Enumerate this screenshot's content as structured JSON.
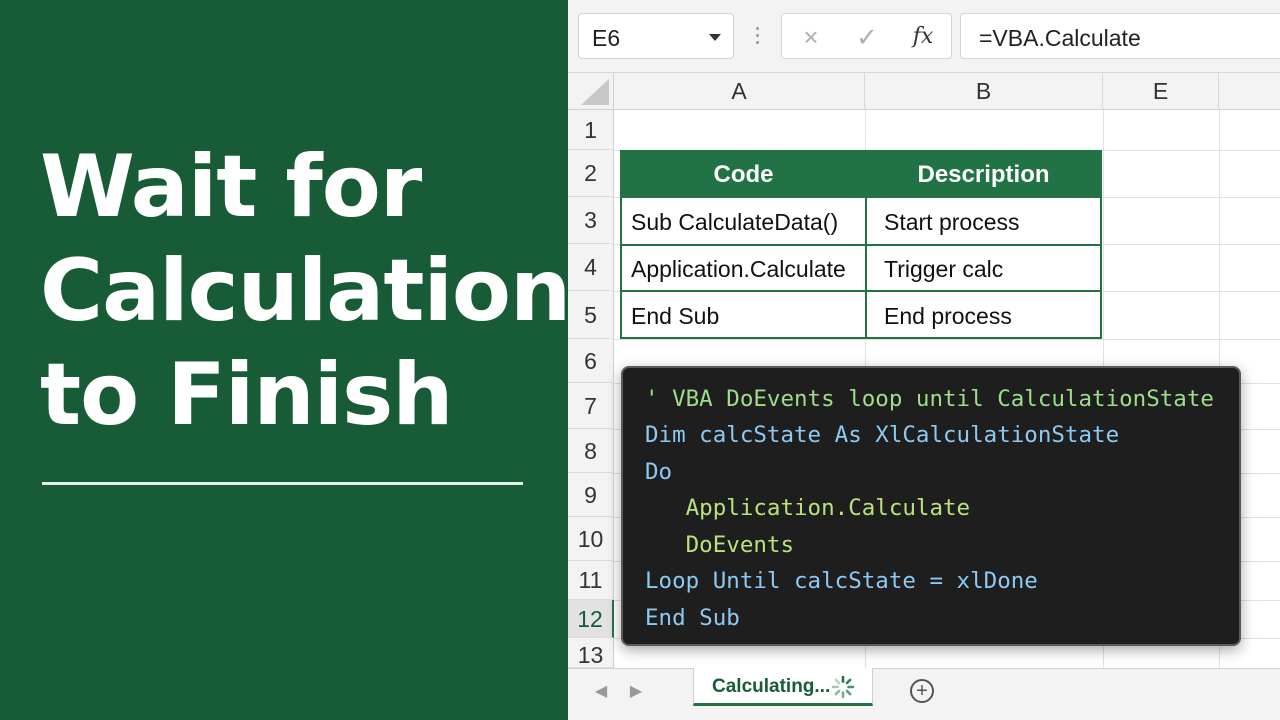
{
  "title": {
    "line1": "Wait for",
    "line2": "Calculation",
    "line3": "to Finish"
  },
  "formula_bar": {
    "name_box": "E6",
    "cancel_icon": "×",
    "enter_icon": "✓",
    "fx_label": "fx",
    "formula": "=VBA.Calculate"
  },
  "columns": [
    "A",
    "B",
    "E"
  ],
  "rows": [
    "1",
    "2",
    "3",
    "4",
    "5",
    "6",
    "7",
    "8",
    "9",
    "10",
    "11",
    "12",
    "13"
  ],
  "active_row": "12",
  "table": {
    "headers": [
      "Code",
      "Description"
    ],
    "rows": [
      [
        "Sub CalculateData()",
        "Start process"
      ],
      [
        "Application.Calculate",
        "Trigger calc"
      ],
      [
        "End Sub",
        "End process"
      ]
    ]
  },
  "code": {
    "lines": [
      "' VBA DoEvents loop until CalculationState",
      "Dim calcState As XlCalculationState",
      "Do",
      "   Application.Calculate",
      "   DoEvents",
      "Loop Until calcState = xlDone",
      "End Sub"
    ]
  },
  "sheet_tab": {
    "label": "Calculating...",
    "add_icon": "+"
  },
  "colors": {
    "brand_green": "#185c37",
    "accent_green": "#217346",
    "code_bg": "#1e1e1e"
  }
}
